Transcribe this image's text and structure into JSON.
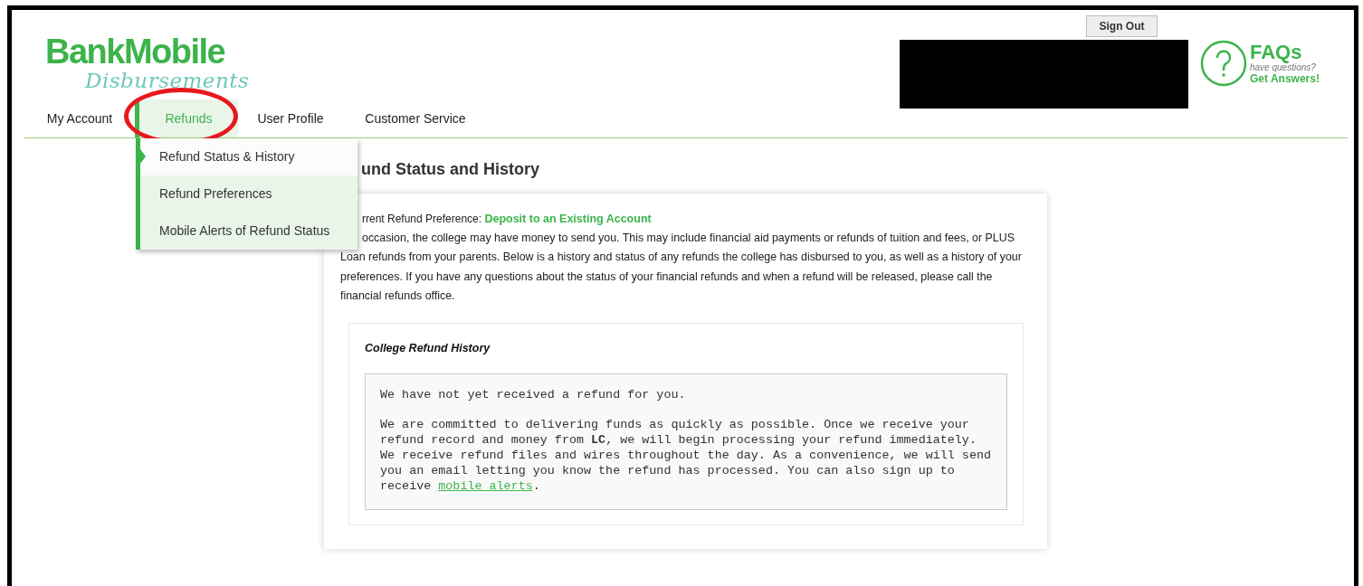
{
  "header": {
    "logo_primary": "BankMobile",
    "logo_secondary": "Disbursements",
    "sign_out": "Sign Out",
    "faq": {
      "title": "FAQs",
      "subtitle": "have questions?",
      "cta": "Get Answers!"
    }
  },
  "nav": [
    {
      "label": "My Account",
      "selected": false
    },
    {
      "label": "Refunds",
      "selected": true
    },
    {
      "label": "User Profile",
      "selected": false
    },
    {
      "label": "Customer Service",
      "selected": false
    }
  ],
  "annotation": {
    "kind": "ellipse",
    "color": "#e8191d"
  },
  "dropdown": [
    {
      "label": "Refund Status & History",
      "selected": true
    },
    {
      "label": "Refund Preferences",
      "selected": false
    },
    {
      "label": "Mobile Alerts of Refund Status",
      "selected": false
    }
  ],
  "page": {
    "heading": "und Status and History",
    "preference_label": "rrent Refund Preference:",
    "preference_value": "Deposit to an Existing Account",
    "intro": "occasion, the college may have money to send you. This may include financial aid payments or refunds of tuition and fees, or PLUS Loan refunds from your parents. Below is a history and status of any refunds the college has disbursed to you, as well as a history of your preferences. If you have any questions about the status of your financial refunds and when a refund will be released, please call the financial refunds office.",
    "history": {
      "title": "College Refund History",
      "message": "We have not yet received a refund for you.",
      "detail": "We are committed to delivering funds as quickly as possible. Once we receive your refund record and money from **LC**, we will begin processing your refund immediately. We receive refund files and wires throughout the day. As a convenience, we will send you an email letting you know the refund has processed. You can also sign up to receive ",
      "link": "mobile alerts",
      "detail_end": "."
    }
  }
}
